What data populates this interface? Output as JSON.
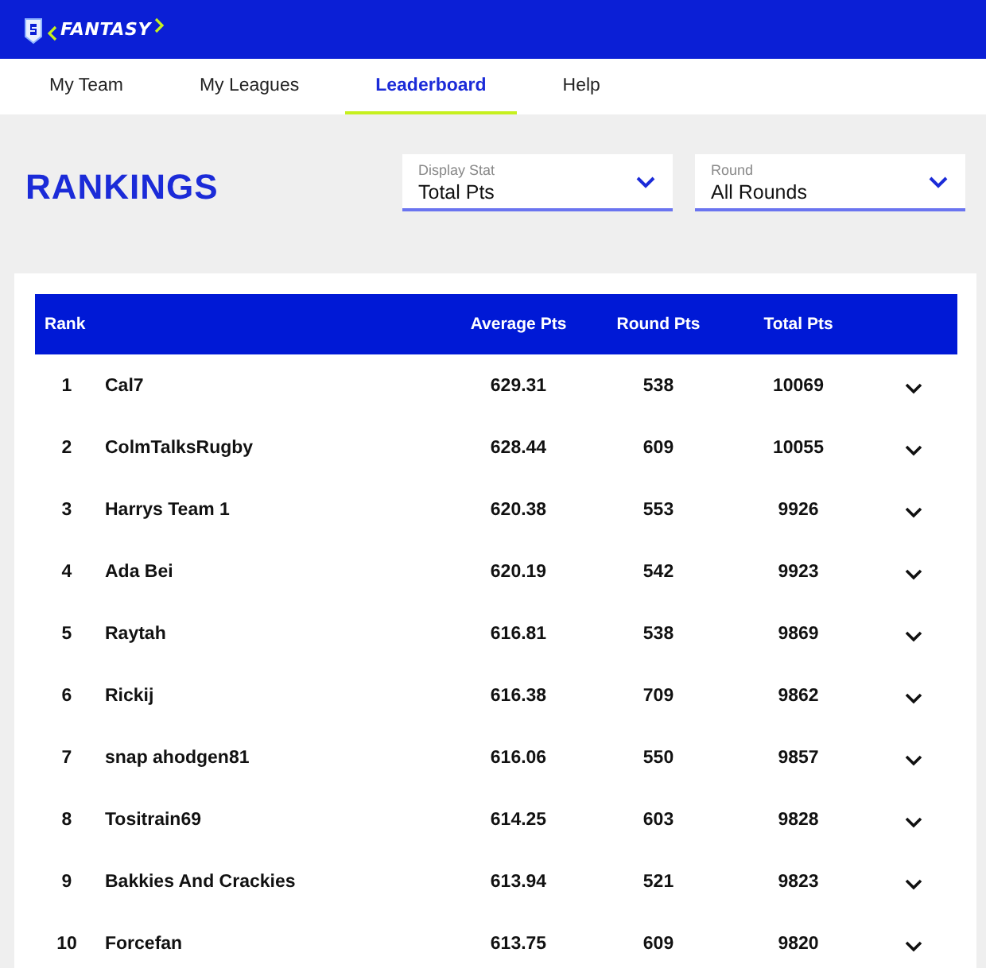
{
  "header": {
    "logo_text": "FANTASY"
  },
  "tabs": [
    {
      "label": "My Team",
      "selected": false
    },
    {
      "label": "My Leagues",
      "selected": false
    },
    {
      "label": "Leaderboard",
      "selected": true
    },
    {
      "label": "Help",
      "selected": false
    }
  ],
  "page_title": "RANKINGS",
  "filters": [
    {
      "label": "Display Stat",
      "value": "Total Pts"
    },
    {
      "label": "Round",
      "value": "All Rounds"
    }
  ],
  "table": {
    "columns": [
      "Rank",
      "Average Pts",
      "Round Pts",
      "Total Pts"
    ],
    "rows": [
      {
        "rank": "1",
        "name": "Cal7",
        "average": "629.31",
        "round": "538",
        "total": "10069"
      },
      {
        "rank": "2",
        "name": "ColmTalksRugby",
        "average": "628.44",
        "round": "609",
        "total": "10055"
      },
      {
        "rank": "3",
        "name": "Harrys Team 1",
        "average": "620.38",
        "round": "553",
        "total": "9926"
      },
      {
        "rank": "4",
        "name": "Ada Bei",
        "average": "620.19",
        "round": "542",
        "total": "9923"
      },
      {
        "rank": "5",
        "name": "Raytah",
        "average": "616.81",
        "round": "538",
        "total": "9869"
      },
      {
        "rank": "6",
        "name": "Rickij",
        "average": "616.38",
        "round": "709",
        "total": "9862"
      },
      {
        "rank": "7",
        "name": "snap ahodgen81",
        "average": "616.06",
        "round": "550",
        "total": "9857"
      },
      {
        "rank": "8",
        "name": "Tositrain69",
        "average": "614.25",
        "round": "603",
        "total": "9828"
      },
      {
        "rank": "9",
        "name": "Bakkies And Crackies",
        "average": "613.94",
        "round": "521",
        "total": "9823"
      },
      {
        "rank": "10",
        "name": "Forcefan",
        "average": "613.75",
        "round": "609",
        "total": "9820"
      }
    ]
  }
}
